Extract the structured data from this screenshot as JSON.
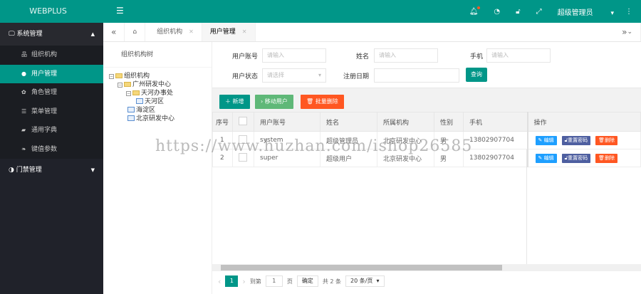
{
  "app": {
    "logo": "WEBPLUS"
  },
  "sidebar": {
    "groups": [
      {
        "label": "系统管理",
        "items": [
          {
            "icon": "sitemap-icon",
            "label": "组织机构"
          },
          {
            "icon": "user-icon",
            "label": "用户管理",
            "active": true
          },
          {
            "icon": "paw-icon",
            "label": "角色管理"
          },
          {
            "icon": "list-icon",
            "label": "菜单管理"
          },
          {
            "icon": "book-icon",
            "label": "通用字典"
          },
          {
            "icon": "leaf-icon",
            "label": "键值参数"
          }
        ]
      },
      {
        "label": "门禁管理"
      }
    ]
  },
  "header": {
    "user": "超级管理员",
    "icons": [
      "bell-icon",
      "theme-icon",
      "lock-icon",
      "fullscreen-icon",
      "more-icon"
    ]
  },
  "tabs": [
    {
      "label": "组织机构"
    },
    {
      "label": "用户管理",
      "active": true
    }
  ],
  "tree": {
    "title": "组织机构树",
    "nodes": [
      "组织机构",
      "广州研发中心",
      "天河办事处",
      "天河区",
      "海淀区",
      "北京研发中心"
    ]
  },
  "search": {
    "fields": [
      {
        "label": "用户账号",
        "placeholder": "请输入"
      },
      {
        "label": "姓名",
        "placeholder": "请输入"
      },
      {
        "label": "手机",
        "placeholder": "请输入"
      },
      {
        "label": "用户状态",
        "placeholder": "请选择"
      },
      {
        "label": "注册日期",
        "placeholder": ""
      }
    ],
    "query": "查询"
  },
  "toolbar": {
    "add": "新增",
    "move": "移动用户",
    "batch_delete": "批量删除"
  },
  "table": {
    "columns": [
      "序号",
      "用户账号",
      "姓名",
      "所属机构",
      "性别",
      "手机",
      "操作"
    ],
    "rows": [
      {
        "no": "1",
        "account": "system",
        "name": "超级管理员",
        "org": "北京研发中心",
        "gender": "男",
        "phone": "13802907704"
      },
      {
        "no": "2",
        "account": "super",
        "name": "超级用户",
        "org": "北京研发中心",
        "gender": "男",
        "phone": "13802907704"
      }
    ],
    "actions": {
      "edit": "编辑",
      "reset": "重置密码",
      "delete": "删除"
    }
  },
  "pagination": {
    "current": "1",
    "goto": "到第",
    "page_input": "1",
    "page_unit": "页",
    "confirm": "确定",
    "total": "共 2 条",
    "page_size": "20 条/页"
  },
  "watermark": "https://www.huzhan.com/ishop26585",
  "colors": {
    "primary": "#009688",
    "sidebar": "#20222a",
    "move": "#5fb878",
    "danger": "#ff5722",
    "edit": "#1e9fff",
    "reset": "#4e5fa0"
  }
}
